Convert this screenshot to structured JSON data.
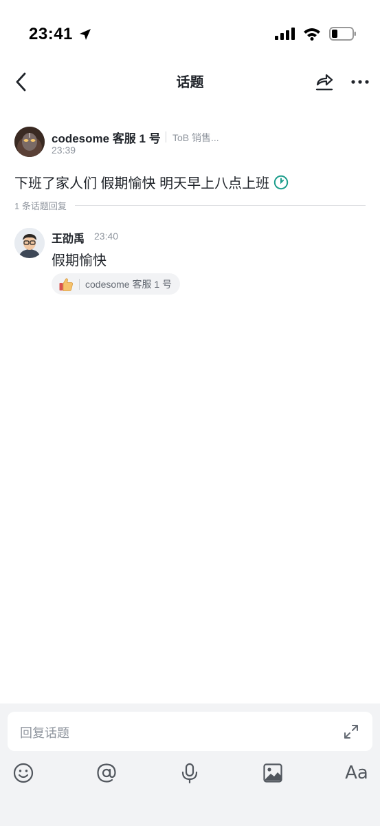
{
  "status_bar": {
    "time": "23:41"
  },
  "header": {
    "title": "话题"
  },
  "post": {
    "author": "codesome 客服 1 号",
    "department": "ToB 销售...",
    "time": "23:39",
    "content": "下班了家人们 假期愉快 明天早上八点上班"
  },
  "reply_count": "1 条话题回复",
  "replies": [
    {
      "author": "王劭禹",
      "time": "23:40",
      "content": "假期愉快",
      "reaction": {
        "icon": "thumbs-up-icon",
        "user": "codesome 客服 1 号"
      }
    }
  ],
  "composer": {
    "placeholder": "回复话题",
    "tools": [
      "emoji-icon",
      "mention-icon",
      "microphone-icon",
      "image-icon",
      "text-format-icon"
    ],
    "format_label": "Aa"
  },
  "colors": {
    "accent": "#1e9e8c",
    "secondary_text": "#8f959e",
    "composer_bg": "#f2f3f5"
  }
}
